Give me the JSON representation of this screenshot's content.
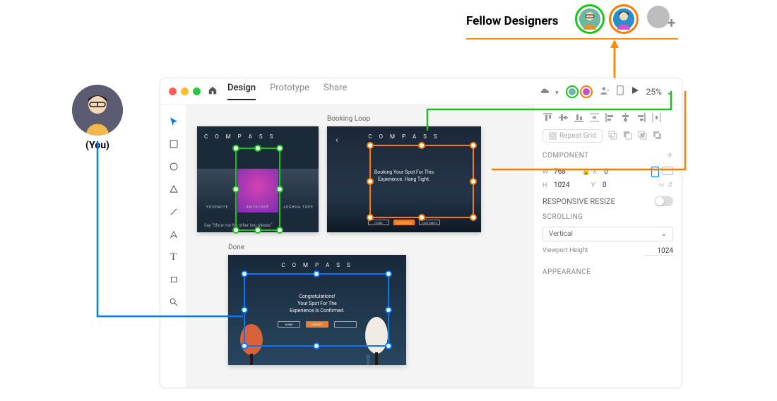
{
  "annotations": {
    "you_label": "(You)",
    "fellow_label": "Fellow Designers"
  },
  "app": {
    "tabs": {
      "design": "Design",
      "prototype": "Prototype",
      "share": "Share"
    },
    "zoom": "25%"
  },
  "artboards": {
    "ab1": {
      "label": "",
      "brand": "C O M P A S S",
      "panels": [
        "YOSEMITE",
        "ANTELOPE",
        "JOSHUA TREE"
      ],
      "footer": "Say \"Show me the other two please.\""
    },
    "ab2": {
      "label": "Booking Loop",
      "brand": "C O M P A S S",
      "msg_l1": "Booking Your Spot For This",
      "msg_l2": "Experience. Hang Tight.",
      "pills": [
        "HOME",
        "EXPERIENCE",
        "CUSTOMIZE"
      ]
    },
    "ab3": {
      "label": "Done",
      "brand": "C O M P A S S",
      "msg_l1": "Congratulations!",
      "msg_l2": "Your Spot For The",
      "msg_l3": "Experience Is Confirmed.",
      "pills": [
        "HOME",
        "RECEIPT",
        ""
      ]
    }
  },
  "inspector": {
    "repeat_grid": "Repeat Grid",
    "component": "COMPONENT",
    "w_label": "W",
    "w_value": "768",
    "x_label": "X",
    "x_value": "0",
    "h_label": "H",
    "h_value": "1024",
    "y_label": "Y",
    "y_value": "0",
    "responsive": "RESPONSIVE RESIZE",
    "scrolling": "SCROLLING",
    "scroll_mode": "Vertical",
    "viewport_label": "Viewport Height",
    "viewport_value": "1024",
    "appearance": "APPEARANCE"
  }
}
